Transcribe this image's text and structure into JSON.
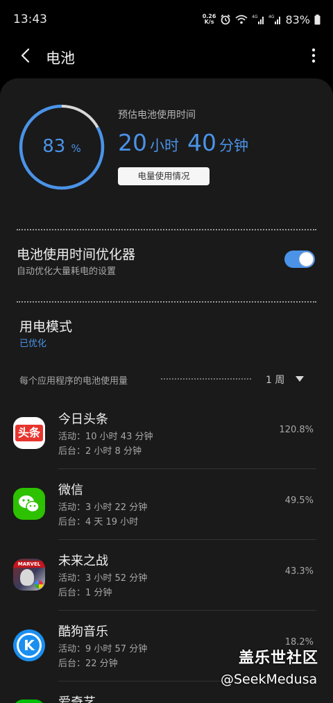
{
  "status_bar": {
    "time": "13:43",
    "net_speed_value": "0.26",
    "net_speed_unit": "K/s",
    "battery_percent": "83%"
  },
  "header": {
    "title": "电池",
    "back_icon": "back-arrow-icon",
    "more_icon": "more-vertical-icon"
  },
  "battery": {
    "level_percent": 83,
    "level_number": "83",
    "level_unit": "%",
    "estimate_label": "预估电池使用时间",
    "hours": "20",
    "hours_unit": "小时",
    "minutes": "40",
    "minutes_unit": "分钟",
    "usage_button": "电量使用情况",
    "accent_color": "#4a93e8"
  },
  "optimizer": {
    "title": "电池使用时间优化器",
    "subtitle": "自动优化大量耗电的设置",
    "enabled": true
  },
  "power_mode": {
    "title": "用电模式",
    "value": "已优化"
  },
  "usage_section": {
    "label": "每个应用程序的电池使用量",
    "period": "1 周"
  },
  "apps": [
    {
      "name": "今日头条",
      "active": "活动：10 小时 43 分钟",
      "background": "后台：2 小时 8 分钟",
      "percent": "120.8%",
      "icon": "toutiao-icon",
      "icon_text": "头条"
    },
    {
      "name": "微信",
      "active": "活动：3 小时 22 分钟",
      "background": "后台：4 天 19 小时",
      "percent": "49.5%",
      "icon": "wechat-icon"
    },
    {
      "name": "未来之战",
      "active": "活动：3 小时 52 分钟",
      "background": "后台：1 分钟",
      "percent": "43.3%",
      "icon": "future-war-icon",
      "icon_text": "MARVEL"
    },
    {
      "name": "酷狗音乐",
      "active": "活动：9 小时 57 分钟",
      "background": "后台：22 分钟",
      "percent": "18.2%",
      "icon": "kugou-icon",
      "icon_text": "K"
    },
    {
      "name": "爱奇艺",
      "icon": "iqiyi-icon"
    }
  ],
  "watermark": {
    "site": "盖乐世社区",
    "handle": "@SeekMedusa"
  }
}
